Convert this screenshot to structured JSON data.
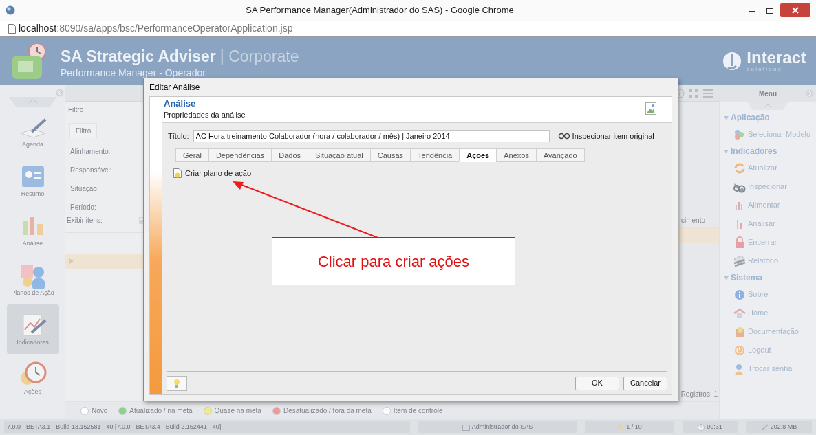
{
  "browser": {
    "title": "SA Performance Manager(Administrador do SAS) - Google Chrome",
    "url_host": "localhost",
    "url_path": ":8090/sa/apps/bsc/PerformanceOperatorApplication.jsp"
  },
  "app_header": {
    "title": "SA Strategic Adviser",
    "edition": "| Corporate",
    "subtitle": "Performance Manager - Operador",
    "brand": "Interact",
    "brand_sub": "s o l u t i o n s"
  },
  "nav": [
    {
      "label": "Agenda",
      "selected": false,
      "kind": "agenda"
    },
    {
      "label": "Resumo",
      "selected": false,
      "kind": "resumo"
    },
    {
      "label": "Análise",
      "selected": false,
      "kind": "analise"
    },
    {
      "label": "Planos de Ação",
      "selected": false,
      "kind": "planos"
    },
    {
      "label": "Indicadores",
      "selected": true,
      "kind": "indicadores"
    },
    {
      "label": "Ações",
      "selected": false,
      "kind": "acoes"
    }
  ],
  "filter": {
    "header": "Filtro",
    "tab": "Filtro",
    "fields": [
      "Alinhamento:",
      "Responsável:",
      "Situação:",
      "Período:"
    ],
    "show_items": {
      "label": "Exibir itens:",
      "checked": true
    }
  },
  "column_fragment": "cimento",
  "records": "Registros: 1",
  "legend": [
    {
      "label": "Novo",
      "kind": "dot",
      "color": "#ffffff"
    },
    {
      "label": "Atualizado / na meta",
      "kind": "dot",
      "color": "#8fd18f"
    },
    {
      "label": "Quase na meta",
      "kind": "dot",
      "color": "#f0ea8a"
    },
    {
      "label": "Desatualizado / fora da meta",
      "kind": "dot",
      "color": "#ee9a9a"
    },
    {
      "label": "Item de controle",
      "kind": "control",
      "color": "#ffffff"
    }
  ],
  "menu": {
    "title": "Menu",
    "sections": [
      {
        "label": "Aplicação",
        "expanded": true,
        "items": [
          {
            "label": "Selecionar Modelo",
            "kind": "model"
          }
        ]
      },
      {
        "label": "Indicadores",
        "expanded": true,
        "items": [
          {
            "label": "Atualizar",
            "kind": "refresh"
          },
          {
            "label": "Inspecionar",
            "kind": "glasses"
          },
          {
            "label": "Alimentar",
            "kind": "bars"
          },
          {
            "label": "Analisar",
            "kind": "chart"
          },
          {
            "label": "Encerrar",
            "kind": "lock"
          },
          {
            "label": "Relatório",
            "kind": "report"
          }
        ]
      },
      {
        "label": "Sistema",
        "expanded": true,
        "items": [
          {
            "label": "Sobre",
            "kind": "info"
          },
          {
            "label": "Home",
            "kind": "home"
          },
          {
            "label": "Documentação",
            "kind": "doc"
          },
          {
            "label": "Logout",
            "kind": "power"
          },
          {
            "label": "Trocar senha",
            "kind": "user"
          }
        ]
      }
    ]
  },
  "dialog": {
    "title": "Editar Análise",
    "heading": "Análise",
    "subheading": "Propriedades da análise",
    "title_label": "Título:",
    "title_value": "AC Hora treinamento Colaborador (hora / colaborador / mês) | Janeiro 2014",
    "inspect_link": "Inspecionar item original",
    "tabs": [
      {
        "label": "Geral",
        "selected": false
      },
      {
        "label": "Dependências",
        "selected": false
      },
      {
        "label": "Dados",
        "selected": false
      },
      {
        "label": "Situação atual",
        "selected": false
      },
      {
        "label": "Causas",
        "selected": false
      },
      {
        "label": "Tendência",
        "selected": false
      },
      {
        "label": "Ações",
        "selected": true
      },
      {
        "label": "Anexos",
        "selected": false
      },
      {
        "label": "Avançado",
        "selected": false
      }
    ],
    "action": "Criar plano de ação",
    "buttons": [
      "OK",
      "Cancelar"
    ]
  },
  "annotation": {
    "text": "Clicar para criar ações"
  },
  "status_bar": {
    "version": "7.0.0 - BETA3.1 - Build 13.152581 - 40 [7.0.0 - BETA3.4 - Build 2.152441 - 40]",
    "user": "Administrador do SAS",
    "pages": "1 / 10",
    "time": "00:31",
    "memory": "202.8 MB"
  }
}
